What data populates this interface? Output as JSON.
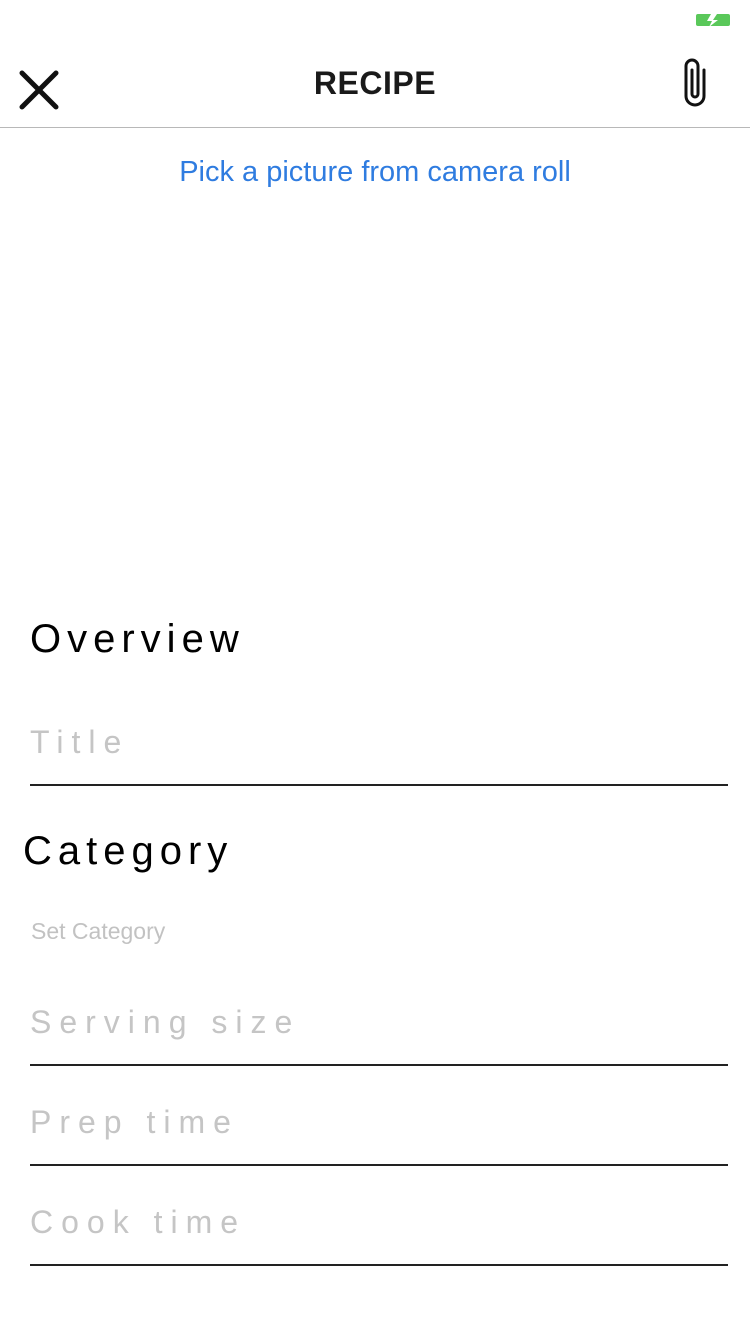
{
  "status_bar": {
    "battery_icon": "battery-charging-icon",
    "battery_color": "#5ac85a"
  },
  "nav": {
    "title": "RECIPE",
    "close_icon": "close-icon",
    "attach_icon": "paperclip-icon"
  },
  "photo": {
    "pick_label": "Pick a picture from camera roll",
    "link_color": "#2f7ce0"
  },
  "overview": {
    "heading": "Overview",
    "title_placeholder": "Title"
  },
  "category": {
    "heading": "Category",
    "set_label": "Set Category"
  },
  "details": {
    "serving_placeholder": "Serving size",
    "prep_placeholder": "Prep time",
    "cook_placeholder": "Cook time"
  }
}
